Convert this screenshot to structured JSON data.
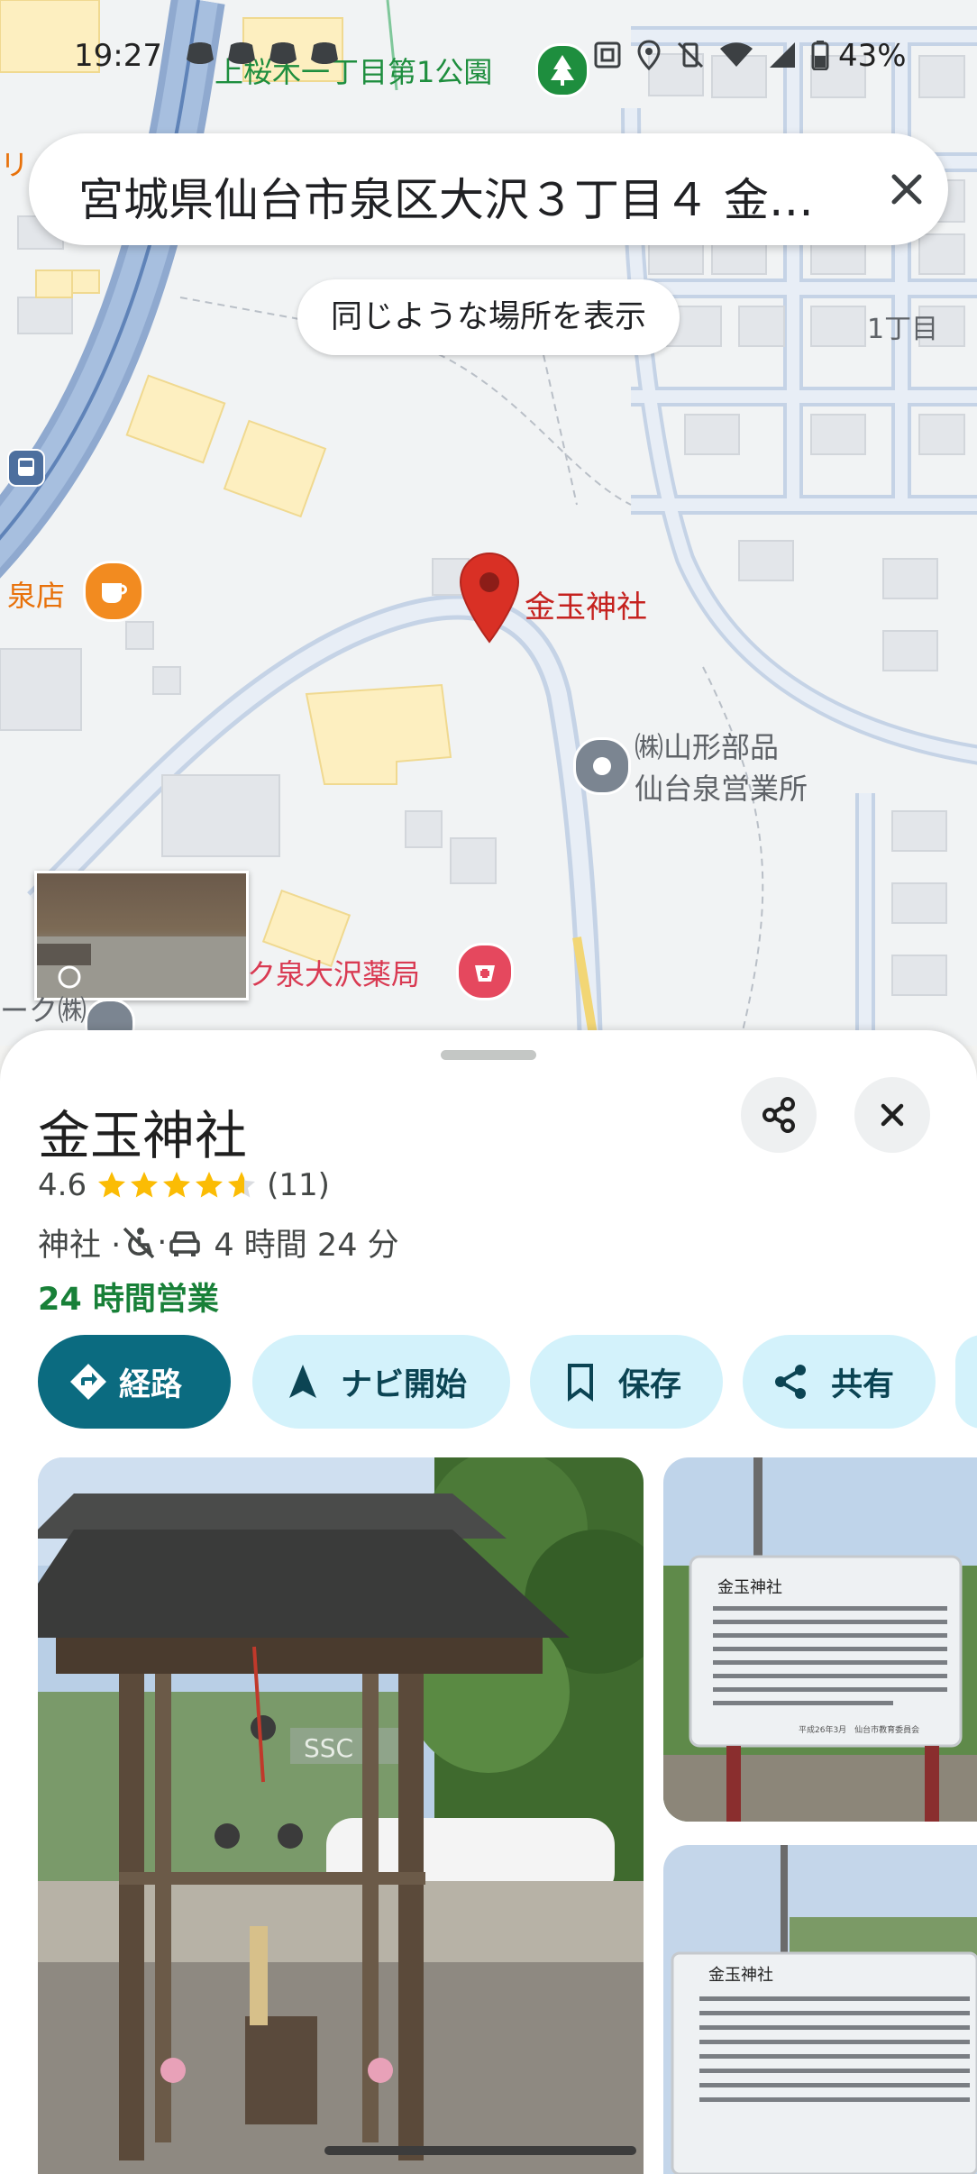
{
  "status_bar": {
    "time": "19:27",
    "battery": "43%",
    "icons": [
      "discord-icon",
      "discord-icon",
      "discord-icon",
      "discord-icon",
      "nfc-icon",
      "location-icon",
      "vibrate-off-icon",
      "wifi-icon",
      "signal-icon",
      "battery-icon"
    ]
  },
  "search": {
    "query": "宮城県仙台市泉区大沢３丁目４ 金…",
    "clear_icon": "close-icon"
  },
  "similar_places_label": "同じような場所を表示",
  "map": {
    "labels": {
      "park": "上桜木一丁目第1公園",
      "district": "1丁目",
      "cafe": "泉店",
      "place": "金玉神社",
      "company_line1": "㈱山形部品",
      "company_line2": "仙台泉営業所",
      "pharmacy": "ク泉大沢薬局",
      "left_fragment_1": "リ",
      "left_fragment_2": "ーク㈱"
    },
    "colors": {
      "pin": "#d93025",
      "road": "#aac0dc",
      "building": "#fdefc0",
      "park_green": "#34a853",
      "cafe_orange": "#f28b20",
      "pharmacy_red": "#e5485e"
    }
  },
  "place": {
    "name": "金玉神社",
    "rating": "4.6",
    "rating_value": 4.6,
    "review_count": "(11)",
    "category": "神社 · ",
    "wheelchair_icon": "accessible-off-icon",
    "separator": " · ",
    "drive_time": "4 時間 24 分",
    "hours": "24 時間営業",
    "accent_color": "#0b6b80",
    "open_color": "#188038"
  },
  "actions": {
    "directions": "経路",
    "start": "ナビ開始",
    "save": "保存",
    "share": "共有"
  },
  "photos": {
    "main_sign_text": "SSC",
    "sign1_title": "金玉神社",
    "sign2_title": "金玉神社",
    "sign1_footer": "平成26年3月　仙台市教育委員会"
  }
}
